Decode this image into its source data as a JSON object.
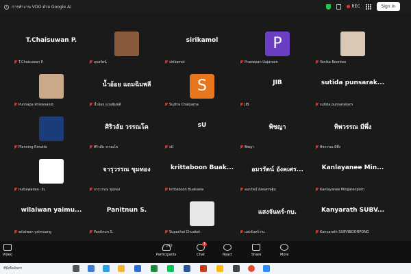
{
  "window": {
    "title": "การทำงาน VDO ด้วย Google AI",
    "rec_label": "REC",
    "sign_in_label": "Sign in"
  },
  "participants": [
    {
      "display": "T.Chaisuwan P.",
      "name": "T.Chaisuwan P.",
      "kind": "text"
    },
    {
      "display": "",
      "name": "อุบลรัตน์",
      "kind": "photo",
      "color": "#8a5a3c"
    },
    {
      "display": "sirikamol",
      "name": "sirikamol",
      "kind": "text"
    },
    {
      "display": "P",
      "name": "Praewpan Uajaroen",
      "kind": "letter",
      "color": "#6b3fc4"
    },
    {
      "display": "",
      "name": "Yanika Boontee",
      "kind": "photo",
      "color": "#d9c8b4"
    },
    {
      "display": "",
      "name": "Punnapa khiewsalub",
      "kind": "photo",
      "color": "#c9a98a"
    },
    {
      "display": "น้ำอ้อย แถมฉิมพลี",
      "name": "น้ำอ้อย แถมฉิมพลี",
      "kind": "text"
    },
    {
      "display": "S",
      "name": "Sujitra Chaiyama",
      "kind": "letter",
      "color": "#e8761f"
    },
    {
      "display": "JIB",
      "name": "JIB",
      "kind": "text"
    },
    {
      "display": "sutida  punsarak...",
      "name": "sutida punsarakam",
      "kind": "text"
    },
    {
      "display": "",
      "name": "Planning Rmutto",
      "kind": "logo",
      "color": "#1a3d7a"
    },
    {
      "display": "ศิริวลัย วรรณโค",
      "name": "ศิริวลัย วรรณโค",
      "kind": "text"
    },
    {
      "display": "sU",
      "name": "sU",
      "kind": "text"
    },
    {
      "display": "พิชญา",
      "name": "พิชญา",
      "kind": "text"
    },
    {
      "display": "ทิพวรรณ มีพึ่ง",
      "name": "ทิพวรรณ มีพึ่ง",
      "kind": "text"
    },
    {
      "display": "",
      "name": "nuttawadee -3L",
      "kind": "logo",
      "color": "#ffffff"
    },
    {
      "display": "จารุวรรณ ขุมทอง",
      "name": "จารุวรรณ ขุมทอง",
      "kind": "text"
    },
    {
      "display": "krittaboon  Buak...",
      "name": "krittaboon Buakaew",
      "kind": "text"
    },
    {
      "display": "อมรรัตน์ อังคเศร...",
      "name": "อมรรัตน์ อังคเศรษฐิน",
      "kind": "text"
    },
    {
      "display": "Kanlayanee  Min...",
      "name": "Kanlayanee Minjjarenporn",
      "kind": "text"
    },
    {
      "display": "wilaiwan  yaimu...",
      "name": "wilaiwan yaimuang",
      "kind": "text"
    },
    {
      "display": "Panitnun S.",
      "name": "Panitnun S.",
      "kind": "text"
    },
    {
      "display": "",
      "name": "Supachai Chuaket",
      "kind": "photo",
      "color": "#e8e8e8"
    },
    {
      "display": "แสงจันทร์-กบ.",
      "name": "แสงจันทร์-กบ.",
      "kind": "text"
    },
    {
      "display": "Kanyarath  SUBV...",
      "name": "Kanyarath SUBVIBOONPONG",
      "kind": "text"
    }
  ],
  "toolbar": {
    "video_label": "Video",
    "participants_label": "Participants",
    "participants_count": "249",
    "chat_label": "Chat",
    "chat_badge": "1",
    "react_label": "React",
    "share_label": "Share",
    "more_label": "More"
  },
  "taskbar": {
    "search_placeholder": "ที่นี่เพื่อค้นหา"
  }
}
